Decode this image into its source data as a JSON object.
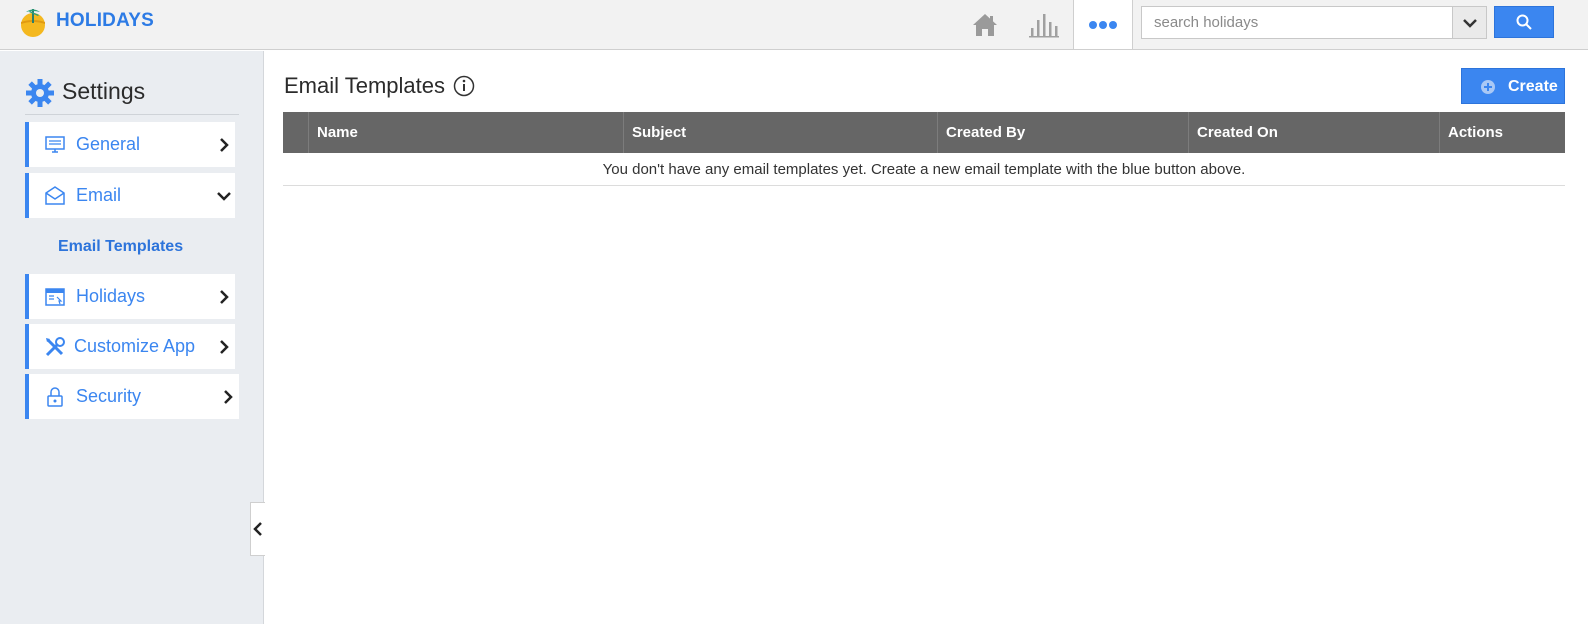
{
  "app": {
    "brand": "HOLIDAYS"
  },
  "topbar": {
    "search_placeholder": "search holidays",
    "icons": [
      "home-icon",
      "bar-chart-icon",
      "more-icon",
      "chevron-down-icon",
      "search-icon"
    ]
  },
  "sidebar": {
    "title": "Settings",
    "items": [
      {
        "label": "General",
        "icon": "monitor-icon",
        "expanded": false
      },
      {
        "label": "Email",
        "icon": "envelope-icon",
        "expanded": true
      },
      {
        "label": "Holidays",
        "icon": "calendar-window-icon",
        "expanded": false
      },
      {
        "label": "Customize App",
        "icon": "tools-icon",
        "expanded": false
      },
      {
        "label": "Security",
        "icon": "lock-icon",
        "expanded": false
      }
    ],
    "subitem": "Email Templates"
  },
  "main": {
    "title": "Email Templates",
    "create_label": "Create",
    "columns": [
      "Name",
      "Subject",
      "Created By",
      "Created On",
      "Actions"
    ],
    "empty_message": "You don't have any email templates yet. Create a new email template with the blue button above."
  },
  "colors": {
    "accent": "#3b86f0",
    "header_bg": "#666666",
    "sidebar_bg": "#eaedf1"
  }
}
